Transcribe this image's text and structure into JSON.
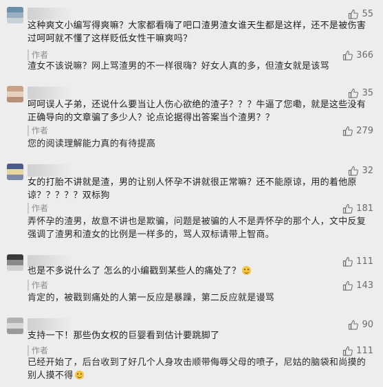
{
  "comments": [
    {
      "avatar_colors": [
        "#6b8fa8",
        "#9ab0c2",
        "#c7d0d6"
      ],
      "likes": "55",
      "text": "这种爽文小编写得爽嘛？大家都看嗨了吧口渣男渣女谁天生都是这样，还不是被伤害过呵呵就不懂了这样贬低女性干嘛爽吗？",
      "author_label": "作者",
      "author_likes": "366",
      "author_reply": "渣女不该说嘛？网上骂渣男的不一样很嗨？好女人真的多，但渣女就是该骂"
    },
    {
      "avatar_colors": [
        "#c9a184",
        "#e6d1c1",
        "#b88f78"
      ],
      "likes": "35",
      "text": "呵呵误人子弟，还说什么要当让人伤心欲绝的渣子？？？牛逼了您嘞，就是这些没有正确导向的文章骗了多少人？论点论据得出答案当个渣男？？",
      "author_label": "作者",
      "author_likes": "279",
      "author_reply": "您的阅读理解能力真的有待提高"
    },
    {
      "avatar_colors": [
        "#4a5a8a",
        "#e8d6a0",
        "#7a8aa8"
      ],
      "likes": "32",
      "text": "女的打胎不讲就是渣，男的让别人怀孕不讲就很正常嘛？还不能原谅，用的着他原谅？？？？？双标狗",
      "author_label": "作者",
      "author_likes": "181",
      "author_reply": "弄怀孕的渣男，故意不讲也是欺骗，问题是被骗的人不是弄怀孕的那个人，文中反复强调了渣男和渣女的比例是一样多的，骂人双标请带上智商。"
    },
    {
      "avatar_colors": [
        "#3a3a3a",
        "#8a8a8a",
        "#d0d0d0"
      ],
      "likes": "111",
      "text": "也是不多说什么了 怎么的小编戳到某些人的痛处了？",
      "text_emoji": "slightly-smiling-emoji",
      "author_label": "作者",
      "author_likes": "143",
      "author_reply": "肯定的，被戳到痛处的人第一反应是暴躁，第二反应就是谩骂"
    },
    {
      "avatar_colors": [
        "#b0b0b0",
        "#d8d8d8",
        "#9a9a9a"
      ],
      "likes": "90",
      "text": "支持一下！那些伪女权的巨婴看到估计要跳脚了",
      "author_label": "作者",
      "author_likes": "111",
      "author_reply": "已经开始了，后台收到了好几个人身攻击顺带侮辱父母的喷子，尼姑的脑袋和尚摸的别人摸不得",
      "author_reply_emoji": "slightly-smiling-emoji"
    }
  ],
  "colors": {
    "background": "#ededed",
    "meta": "#8c8c8c",
    "text": "#1e1e1e"
  }
}
